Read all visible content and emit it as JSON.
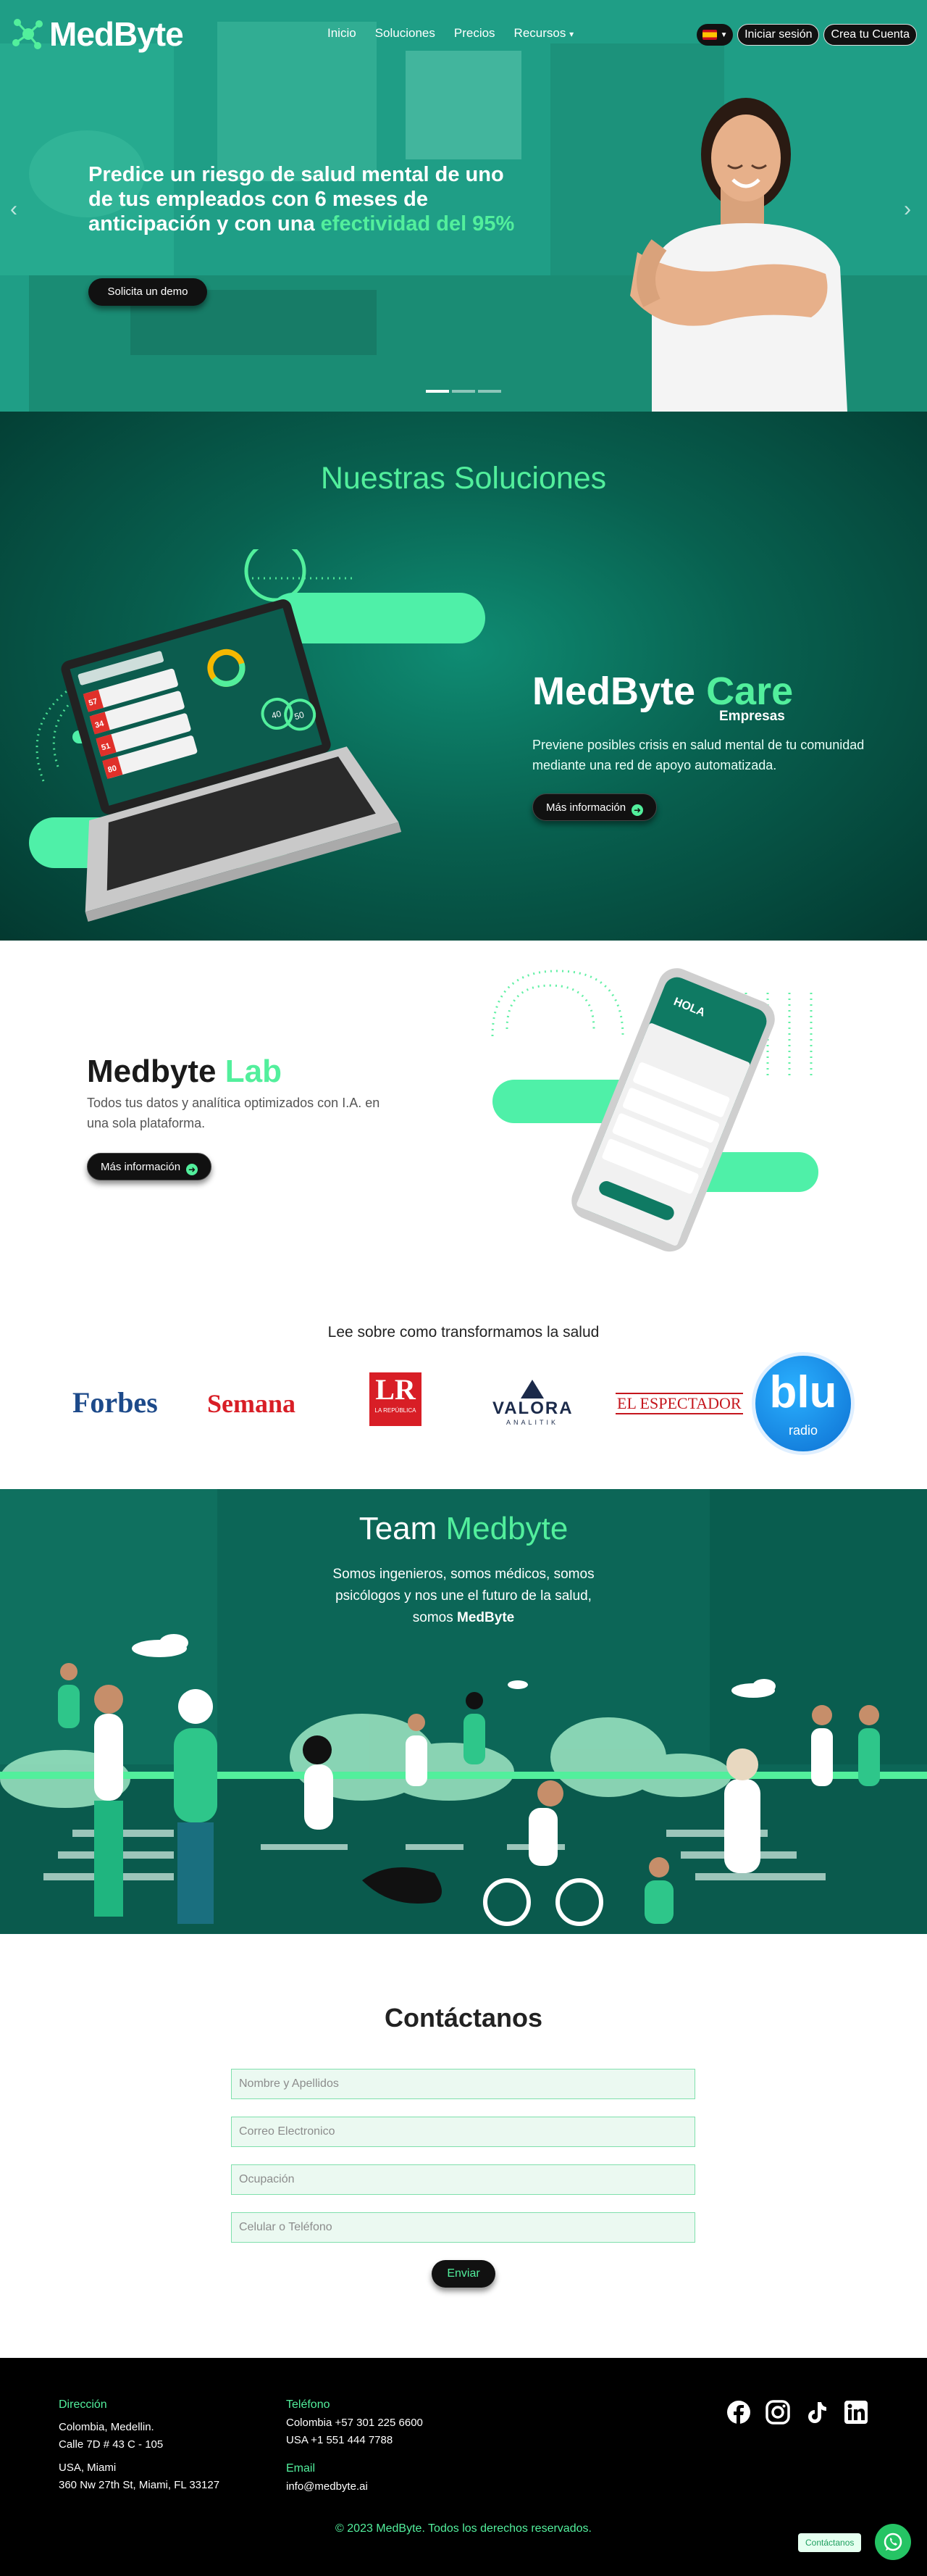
{
  "nav": {
    "logo_text": "MedByte",
    "links": [
      "Inicio",
      "Soluciones",
      "Precios",
      "Recursos"
    ],
    "recursos_caret": "▾",
    "login": "Iniciar sesión",
    "signup": "Crea tu Cuenta"
  },
  "hero": {
    "title_part1": "Predice un riesgo de salud mental de uno de tus empleados con 6 meses de anticipación y con una ",
    "title_accent": "efectividad del 95%",
    "button": "Solicita un demo",
    "prev": "‹",
    "next": "›",
    "slides_total": 3,
    "slide_active": 1
  },
  "solutions": {
    "title": "Nuestras Soluciones",
    "care_title_1": "MedByte",
    "care_title_2": "Care",
    "care_sub": "Empresas",
    "care_desc": "Previene posibles crisis en salud mental de tu comunidad mediante una red de apoyo automatizada.",
    "care_button": "Más información",
    "dash_scores": [
      "57",
      "34",
      "51",
      "80"
    ],
    "dash_gauges": [
      "40",
      "50"
    ]
  },
  "lab": {
    "title_1": "Medbyte",
    "title_2": "Lab",
    "desc": "Todos tus datos y analítica optimizados con I.A. en una sola plataforma.",
    "button": "Más información",
    "phone_title": "HOLA"
  },
  "press": {
    "title": "Lee sobre como transformamos la salud",
    "logos": [
      "Forbes",
      "Semana",
      "LR",
      "LA REPÚBLICA",
      "VALORA",
      "ANALITIK",
      "EL ESPECTADOR",
      "blu",
      "radio"
    ]
  },
  "team": {
    "title_1": "Team",
    "title_2": "Medbyte",
    "desc_1": "Somos ingenieros, somos médicos, somos psicólogos y nos une el futuro de la salud, somos ",
    "desc_brand": "MedByte"
  },
  "contact": {
    "title": "Contáctanos",
    "ph_name": "Nombre y Apellidos",
    "ph_email": "Correo Electronico",
    "ph_job": "Ocupación",
    "ph_phone": "Celular o Teléfono",
    "button": "Enviar"
  },
  "footer": {
    "addr_label": "Dirección",
    "addr_1a": "Colombia, Medellin.",
    "addr_1b": "Calle 7D # 43 C - 105",
    "addr_2a": "USA, Miami",
    "addr_2b": "360 Nw 27th St, Miami, FL 33127",
    "phone_label": "Teléfono",
    "phone_1": "Colombia +57 301 225 6600",
    "phone_2": "USA +1 551 444 7788",
    "email_label": "Email",
    "email": "info@medbyte.ai",
    "copyright": "© 2023 MedByte. Todos los derechos reservados.",
    "chat_label": "Contáctanos",
    "social": [
      "facebook-icon",
      "instagram-icon",
      "tiktok-icon",
      "linkedin-icon"
    ]
  },
  "colors": {
    "accent": "#52ef9c",
    "teal": "#1f9f86",
    "dark": "#111111"
  }
}
